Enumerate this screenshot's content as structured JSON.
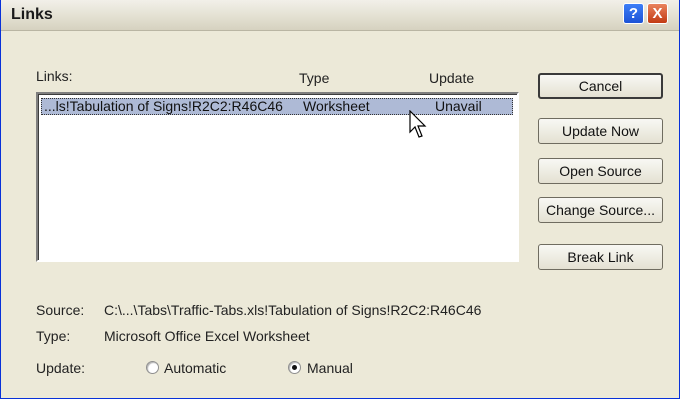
{
  "window": {
    "title": "Links",
    "help_glyph": "?",
    "close_glyph": "X"
  },
  "list": {
    "header_links": "Links:",
    "header_type": "Type",
    "header_update": "Update",
    "rows": [
      {
        "link": "...ls!Tabulation of Signs!R2C2:R46C46",
        "type": "Worksheet",
        "update": "Unavail"
      }
    ]
  },
  "buttons": {
    "cancel": "Cancel",
    "update_now": "Update Now",
    "open_source": "Open Source",
    "change_source": "Change Source...",
    "break_link": "Break Link"
  },
  "details": {
    "source_label": "Source:",
    "source_value": "C:\\...\\Tabs\\Traffic-Tabs.xls!Tabulation of Signs!R2C2:R46C46",
    "type_label": "Type:",
    "type_value": "Microsoft Office Excel Worksheet",
    "update_label": "Update:",
    "update_options": [
      {
        "label": "Automatic",
        "selected": false
      },
      {
        "label": "Manual",
        "selected": true
      }
    ]
  },
  "icons": {
    "help": "question-mark-icon",
    "close": "close-icon",
    "pointer": "mouse-pointer-icon"
  },
  "colors": {
    "dialog_bg": "#ece9d8",
    "selection": "#aebad6",
    "close_red": "#c23a12",
    "help_blue": "#1d53d6"
  }
}
